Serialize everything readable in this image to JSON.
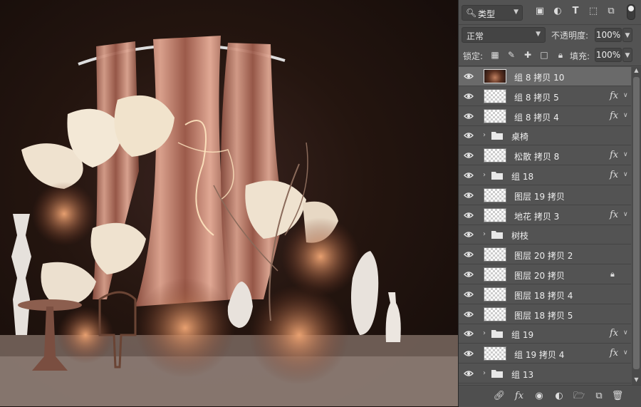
{
  "filter": {
    "kind_label": "类型",
    "icon": "search-icon"
  },
  "blend": {
    "mode": "正常",
    "opacity_label": "不透明度:",
    "opacity_value": "100%"
  },
  "lock": {
    "label": "锁定:",
    "fill_label": "填充:",
    "fill_value": "100%"
  },
  "layers": [
    {
      "name": "组 8 拷贝 10",
      "type": "layer",
      "selected": true,
      "thumb": "image",
      "fx": false,
      "locked": false
    },
    {
      "name": "组 8 拷贝 5",
      "type": "layer",
      "fx": true
    },
    {
      "name": "组 8 拷贝 4",
      "type": "layer",
      "fx": true
    },
    {
      "name": "桌椅",
      "type": "group",
      "fx": false
    },
    {
      "name": "松散 拷贝 8",
      "type": "layer",
      "fx": true
    },
    {
      "name": "组 18",
      "type": "group",
      "fx": true
    },
    {
      "name": "图层 19 拷贝",
      "type": "layer",
      "fx": false
    },
    {
      "name": "地花 拷贝 3",
      "type": "layer",
      "fx": true
    },
    {
      "name": "树枝",
      "type": "group",
      "fx": false
    },
    {
      "name": "图层 20 拷贝 2",
      "type": "layer",
      "fx": false
    },
    {
      "name": "图层 20 拷贝",
      "type": "layer",
      "fx": false,
      "locked": true
    },
    {
      "name": "图层 18 拷贝 4",
      "type": "layer",
      "fx": false
    },
    {
      "name": "图层 18 拷贝 5",
      "type": "layer",
      "fx": false
    },
    {
      "name": "组 19",
      "type": "group",
      "fx": true
    },
    {
      "name": "组 19 拷贝 4",
      "type": "layer",
      "fx": true
    },
    {
      "name": "组 13",
      "type": "group",
      "fx": false
    }
  ],
  "bottom_icons": [
    "link-layers-icon",
    "fx-icon",
    "mask-icon",
    "adjustment-layer-icon",
    "new-group-icon",
    "new-layer-icon",
    "delete-icon"
  ]
}
